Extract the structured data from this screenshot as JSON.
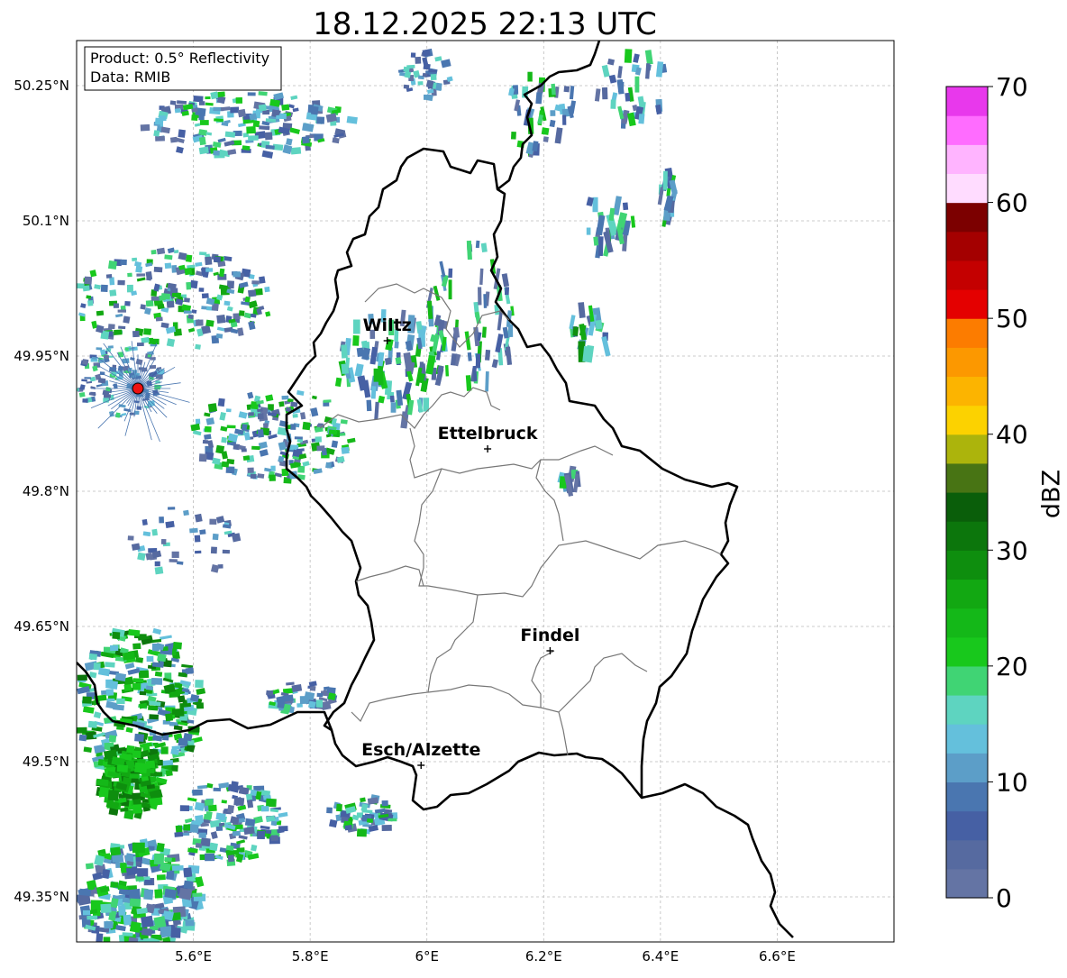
{
  "title": "18.12.2025 22:13 UTC",
  "info_box": {
    "product": "Product: 0.5° Reflectivity",
    "data": "Data: RMIB"
  },
  "map": {
    "lon_range": [
      5.4,
      6.8
    ],
    "lat_range": [
      49.3,
      50.3
    ],
    "x_ticks": [
      {
        "value": 5.6,
        "label": "5.6°E"
      },
      {
        "value": 5.8,
        "label": "5.8°E"
      },
      {
        "value": 6.0,
        "label": "6°E"
      },
      {
        "value": 6.2,
        "label": "6.2°E"
      },
      {
        "value": 6.4,
        "label": "6.4°E"
      },
      {
        "value": 6.6,
        "label": "6.6°E"
      }
    ],
    "y_ticks": [
      {
        "value": 50.25,
        "label": "50.25°N"
      },
      {
        "value": 50.1,
        "label": "50.1°N"
      },
      {
        "value": 49.95,
        "label": "49.95°N"
      },
      {
        "value": 49.8,
        "label": "49.8°N"
      },
      {
        "value": 49.65,
        "label": "49.65°N"
      },
      {
        "value": 49.5,
        "label": "49.5°N"
      },
      {
        "value": 49.35,
        "label": "49.35°N"
      }
    ],
    "gridlines": true,
    "radar_site": {
      "lon": 5.505,
      "lat": 49.914
    },
    "cities": [
      {
        "name": "Wiltz",
        "lon": 5.932,
        "lat": 49.967
      },
      {
        "name": "Ettelbruck",
        "lon": 6.104,
        "lat": 49.847
      },
      {
        "name": "Findel",
        "lon": 6.211,
        "lat": 49.623
      },
      {
        "name": "Esch/Alzette",
        "lon": 5.99,
        "lat": 49.496
      }
    ]
  },
  "colorbar": {
    "label": "dBZ",
    "min": 0,
    "max": 70,
    "ticks": [
      0,
      10,
      20,
      30,
      40,
      50,
      60,
      70
    ],
    "colors": [
      "#6474a4",
      "#566aa0",
      "#4660a4",
      "#4a76b0",
      "#5c9ec8",
      "#64c0dc",
      "#5ed4c0",
      "#40d474",
      "#18c81c",
      "#14b818",
      "#12a812",
      "#0e8e0e",
      "#0c760c",
      "#0a5e0a",
      "#487414",
      "#acb40c",
      "#fcd200",
      "#fcb400",
      "#fc9800",
      "#fc7c00",
      "#e40000",
      "#c40000",
      "#a40000",
      "#7c0000",
      "#ffdcff",
      "#ffb4ff",
      "#ff6cff",
      "#e838ec"
    ]
  }
}
